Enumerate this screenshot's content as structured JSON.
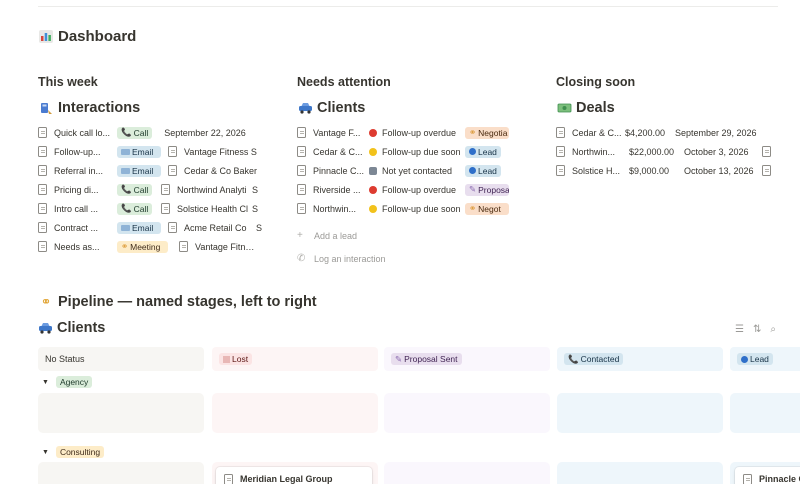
{
  "page": {
    "icon": "bar-chart-icon",
    "title": "Dashboard"
  },
  "this_week": {
    "heading": "This week",
    "db_icon": "phone-log-icon",
    "db_title": "Interactions",
    "rows": [
      {
        "title": "Quick call lo...",
        "type": "Call",
        "date": "September 22, 2026"
      },
      {
        "title": "Follow-up...",
        "type": "Email",
        "related": "Vantage Fitness S"
      },
      {
        "title": "Referral in...",
        "type": "Email",
        "related": "Cedar & Co Baker"
      },
      {
        "title": "Pricing di...",
        "type": "Call",
        "related": "Northwind Analyti",
        "extra": "S"
      },
      {
        "title": "Intro call ...",
        "type": "Call",
        "related": "Solstice Health Cl",
        "extra": "S"
      },
      {
        "title": "Contract ...",
        "type": "Email",
        "related": "Acme Retail Co",
        "extra": "S"
      },
      {
        "title": "Needs as...",
        "type": "Meeting",
        "related": "Vantage Fitness"
      }
    ]
  },
  "needs_attention": {
    "heading": "Needs attention",
    "db_icon": "car-icon",
    "db_title": "Clients",
    "rows": [
      {
        "name": "Vantage F...",
        "status": "Follow-up overdue",
        "status_icon": "red-circle-icon",
        "stage": "Negotia"
      },
      {
        "name": "Cedar & C...",
        "status": "Follow-up due soon",
        "status_icon": "yellow-circle-icon",
        "stage": "Lead"
      },
      {
        "name": "Pinnacle C...",
        "status": "Not yet contacted",
        "status_icon": "gray-square-icon",
        "stage": "Lead"
      },
      {
        "name": "Riverside ...",
        "status": "Follow-up overdue",
        "status_icon": "red-circle-icon",
        "stage": "Proposa"
      },
      {
        "name": "Northwin...",
        "status": "Follow-up due soon",
        "status_icon": "yellow-circle-icon",
        "stage": "Negot"
      }
    ],
    "add_label": "Add a lead",
    "log_label": "Log an interaction"
  },
  "closing_soon": {
    "heading": "Closing soon",
    "db_icon": "money-icon",
    "db_title": "Deals",
    "rows": [
      {
        "name": "Cedar & C...",
        "amount": "$4,200.00",
        "date": "September 29, 2026"
      },
      {
        "name": "Northwin...",
        "amount": "$22,000.00",
        "date": "October 3, 2026"
      },
      {
        "name": "Solstice H...",
        "amount": "$9,000.00",
        "date": "October 13, 2026"
      }
    ]
  },
  "pipeline": {
    "icon": "handshake-icon",
    "title": "Pipeline — named stages, left to right",
    "board_icon": "car-icon",
    "board_title": "Clients",
    "columns": [
      "No Status",
      "Lost",
      "Proposal Sent",
      "Contacted",
      "Lead"
    ],
    "groups": [
      "Agency",
      "Consulting"
    ],
    "cards": [
      "Meridian Legal Group",
      "Pinnacle C"
    ]
  },
  "colors": {
    "accent_blue": "#2383e2",
    "call_tag": "#dbeddb",
    "email_tag": "#d3e5ef",
    "meeting_tag": "#fdecc8",
    "lost_bg": "#fdebec",
    "proposal_bg": "#f8f3fc",
    "contacted_bg": "#e7f3f8"
  }
}
